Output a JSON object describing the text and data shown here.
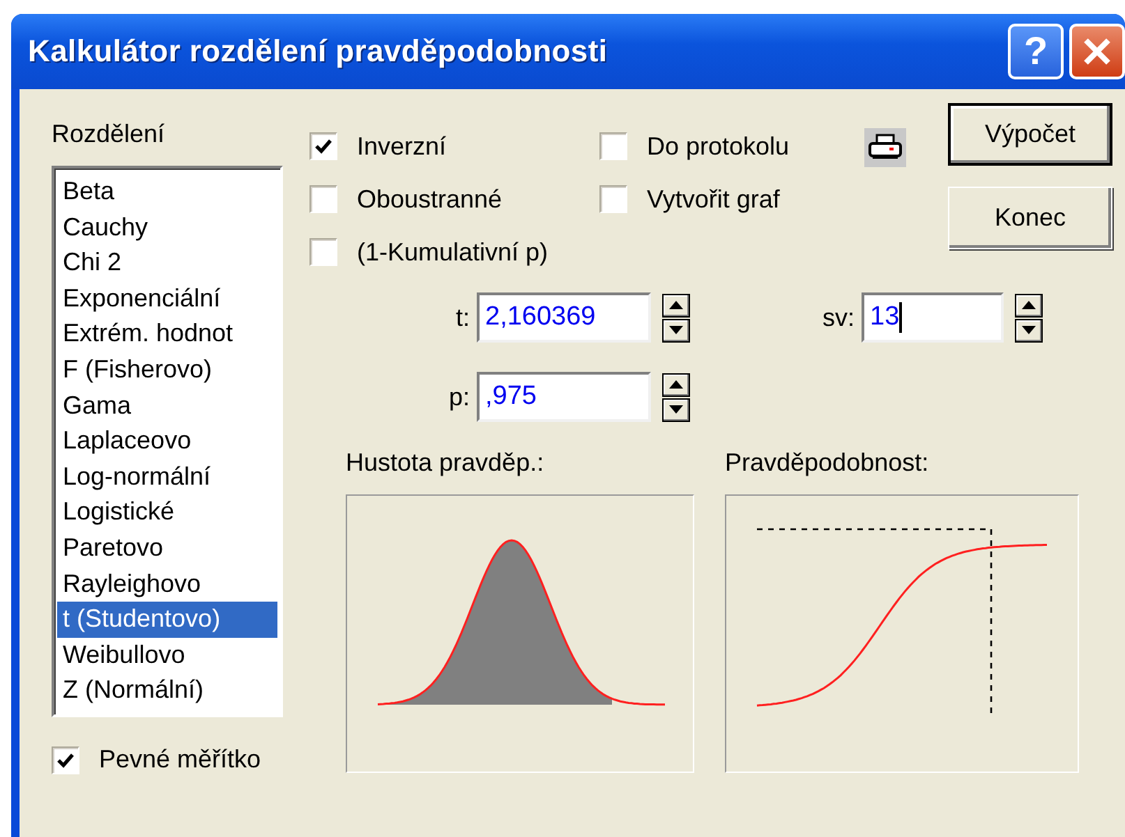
{
  "window": {
    "title": "Kalkulátor rozdělení pravděpodobnosti",
    "help_label": "?"
  },
  "distribution": {
    "label": "Rozdělení",
    "items": [
      {
        "label": "Beta",
        "selected": false
      },
      {
        "label": "Cauchy",
        "selected": false
      },
      {
        "label": "Chi 2",
        "selected": false
      },
      {
        "label": "Exponenciální",
        "selected": false
      },
      {
        "label": "Extrém. hodnot",
        "selected": false
      },
      {
        "label": "F (Fisherovo)",
        "selected": false
      },
      {
        "label": "Gama",
        "selected": false
      },
      {
        "label": "Laplaceovo",
        "selected": false
      },
      {
        "label": "Log-normální",
        "selected": false
      },
      {
        "label": "Logistické",
        "selected": false
      },
      {
        "label": "Paretovo",
        "selected": false
      },
      {
        "label": "Rayleighovo",
        "selected": false
      },
      {
        "label": "t (Studentovo)",
        "selected": true
      },
      {
        "label": "Weibullovo",
        "selected": false
      },
      {
        "label": "Z (Normální)",
        "selected": false
      }
    ]
  },
  "options_left": [
    {
      "label": "Inverzní",
      "checked": true
    },
    {
      "label": "Oboustranné",
      "checked": false
    },
    {
      "label": "(1-Kumulativní p)",
      "checked": false
    }
  ],
  "options_right": [
    {
      "label": "Do protokolu",
      "checked": false
    },
    {
      "label": "Vytvořit graf",
      "checked": false
    }
  ],
  "buttons": [
    {
      "label": "Výpočet",
      "default": true
    },
    {
      "label": "Konec",
      "default": false
    }
  ],
  "fields": {
    "t": {
      "label": "t:",
      "value": "2,160369",
      "focused": false
    },
    "p": {
      "label": "p:",
      "value": ",975",
      "focused": false
    },
    "sv": {
      "label": "sv:",
      "value": "13",
      "focused": true
    }
  },
  "density": {
    "label": "Hustota pravděp.:"
  },
  "probability": {
    "label": "Pravděpodobnost:"
  },
  "fixed_scale": {
    "label": "Pevné měřítko",
    "checked": true
  }
}
